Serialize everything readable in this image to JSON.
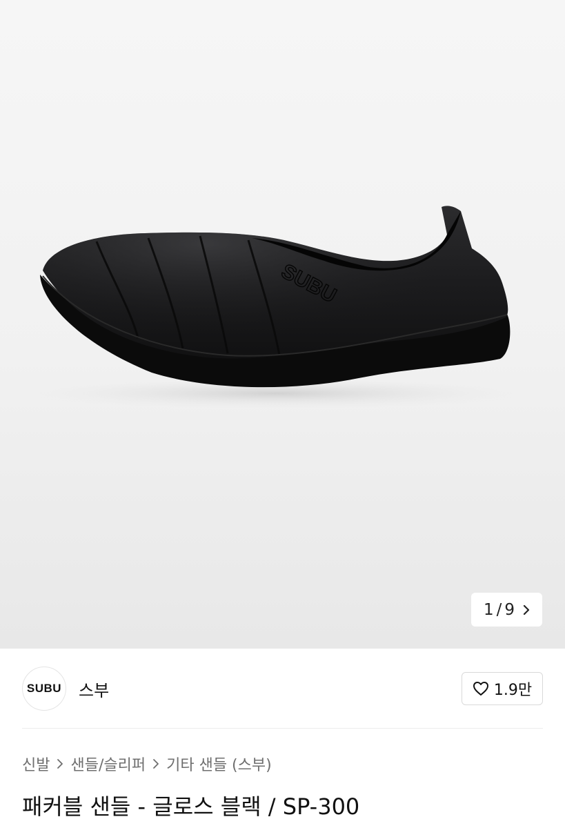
{
  "gallery": {
    "image_alt": "product-photo-black-quilted-slip-on",
    "logo_embossed": "SUBU",
    "counter": {
      "current": "1",
      "separator": "/",
      "total": "9"
    }
  },
  "brand": {
    "logo_text": "SUBU",
    "name": "스부",
    "like_count": "1.9만"
  },
  "breadcrumb": {
    "items": [
      "신발",
      "샌들/슬리퍼",
      "기타 샌들 (스부)"
    ]
  },
  "product": {
    "title": "패커블 샌들 - 글로스 블랙 / SP-300"
  },
  "colors": {
    "background": "#ffffff",
    "text": "#111111",
    "muted": "#6e6e6e"
  },
  "icons": [
    "chevron-right-icon",
    "heart-icon"
  ]
}
